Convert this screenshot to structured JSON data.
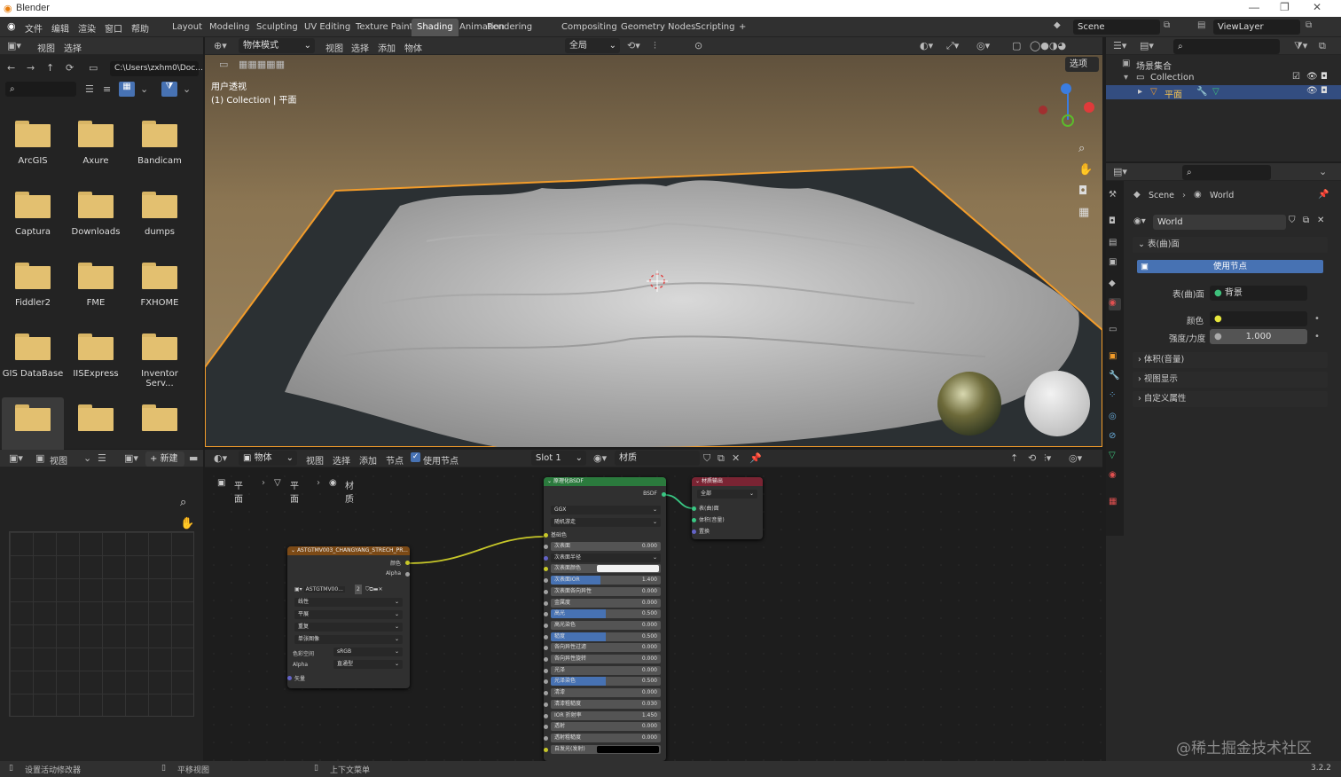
{
  "app": {
    "title": "Blender",
    "version": "3.2.2"
  },
  "menu": [
    "文件",
    "编辑",
    "渲染",
    "窗口",
    "帮助"
  ],
  "workspaces": [
    "Layout",
    "Modeling",
    "Sculpting",
    "UV Editing",
    "Texture Paint",
    "Shading",
    "Animation",
    "Rendering",
    "Compositing",
    "Geometry Nodes",
    "Scripting",
    "+"
  ],
  "scene": {
    "name": "Scene",
    "view_layer": "ViewLayer"
  },
  "filebrowser": {
    "menus": [
      "视图",
      "选择"
    ],
    "path": "C:\\Users\\zxhm0\\Doc...",
    "folders": [
      "ArcGIS",
      "Axure",
      "Bandicam",
      "Captura",
      "Downloads",
      "dumps",
      "Fiddler2",
      "FME",
      "FXHOME",
      "GIS DataBase",
      "IISExpress",
      "Inventor Serv...",
      "",
      "",
      ""
    ]
  },
  "viewport": {
    "mode": "物体模式",
    "menus": [
      "视图",
      "选择",
      "添加",
      "物体"
    ],
    "orientation": "全局",
    "options": "选项",
    "view_name": "用户透视",
    "collection_label": "(1) Collection | 平面"
  },
  "outliner": {
    "root": "场景集合",
    "collection": "Collection",
    "object": "平面"
  },
  "properties": {
    "breadcrumb_scene": "Scene",
    "breadcrumb_world": "World",
    "world_name": "World",
    "surface_panel": "表(曲)面",
    "use_nodes": "使用节点",
    "surface_label": "表(曲)面",
    "surface_value": "背景",
    "color_label": "颜色",
    "strength_label": "强度/力度",
    "strength_value": "1.000",
    "volume_panel": "体积(音量)",
    "viewport_panel": "视图显示",
    "custom_panel": "自定义属性"
  },
  "image_editor": {
    "menu": "视图",
    "new_button": "新建"
  },
  "node_editor": {
    "object_menu": "物体",
    "menus": [
      "视图",
      "选择",
      "添加",
      "节点"
    ],
    "use_nodes": "使用节点",
    "slot": "Slot 1",
    "material": "材质",
    "breadcrumb": [
      "平面",
      "平面",
      "材质"
    ]
  },
  "texture_node": {
    "title": "ASTGTMV003_CHANGYANG_STRECH_PR...",
    "out_color": "颜色",
    "out_alpha": "Alpha",
    "image_name": "ASTGTMV00...",
    "users": "2",
    "interp": "线性",
    "proj": "平展",
    "ext": "重复",
    "source": "单张图像",
    "colorspace_label": "色彩空间",
    "colorspace": "sRGB",
    "alpha_label": "Alpha",
    "alpha": "直通型",
    "vector": "矢量"
  },
  "bsdf_node": {
    "title": "原理化BSDF",
    "output": "BSDF",
    "dist": "GGX",
    "sss_method": "随机游走",
    "base_color": "基础色",
    "rows": [
      {
        "l": "次表面",
        "v": "0.000"
      },
      {
        "l": "次表面半径",
        "v": ""
      },
      {
        "l": "次表面颜色",
        "v": ""
      },
      {
        "l": "次表面IOR",
        "v": "1.400"
      },
      {
        "l": "次表面各向异性",
        "v": "0.000"
      },
      {
        "l": "金属度",
        "v": "0.000"
      },
      {
        "l": "高光",
        "v": "0.500"
      },
      {
        "l": "高光染色",
        "v": "0.000"
      },
      {
        "l": "糙度",
        "v": "0.500"
      },
      {
        "l": "各向异性过滤",
        "v": "0.000"
      },
      {
        "l": "各向异性旋转",
        "v": "0.000"
      },
      {
        "l": "光泽",
        "v": "0.000"
      },
      {
        "l": "光泽染色",
        "v": "0.500"
      },
      {
        "l": "清漆",
        "v": "0.000"
      },
      {
        "l": "清漆粗糙度",
        "v": "0.030"
      },
      {
        "l": "IOR 折射率",
        "v": "1.450"
      },
      {
        "l": "透射",
        "v": "0.000"
      },
      {
        "l": "透射粗糙度",
        "v": "0.000"
      },
      {
        "l": "自发光(发射)",
        "v": ""
      }
    ]
  },
  "output_node": {
    "title": "材质输出",
    "target": "全部",
    "inputs": [
      "表(曲)面",
      "体积(音量)",
      "置换"
    ]
  },
  "status": {
    "left": "设置活动修改器",
    "mid": "平移视图",
    "right": "上下文菜单"
  },
  "watermark": "@稀土掘金技术社区"
}
